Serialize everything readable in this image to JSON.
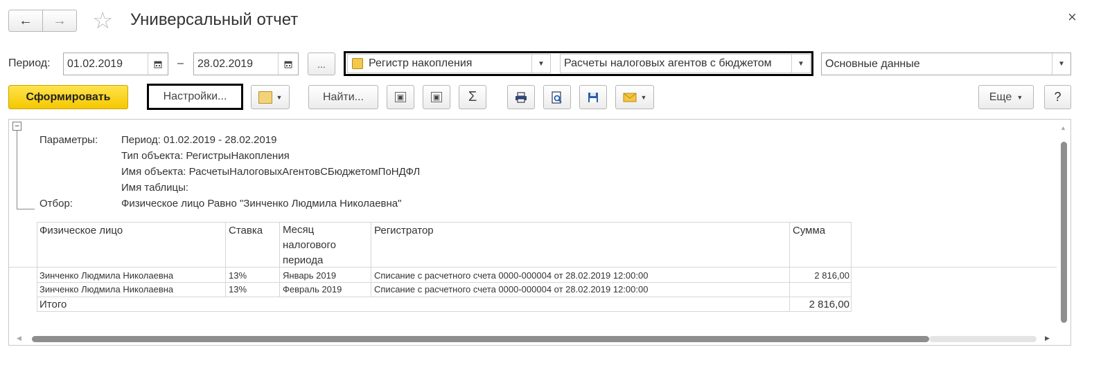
{
  "window": {
    "title": "Универсальный отчет",
    "close": "×"
  },
  "nav": {
    "back": "←",
    "forward": "→",
    "favorite": "☆"
  },
  "period": {
    "label": "Период:",
    "from": "01.02.2019",
    "dash": "–",
    "to": "28.02.2019",
    "more": "..."
  },
  "selectors": {
    "object_type": "Регистр накопления",
    "object_name": "Расчеты налоговых агентов с бюджетом",
    "table": "Основные данные"
  },
  "toolbar": {
    "generate": "Сформировать",
    "settings": "Настройки...",
    "find": "Найти...",
    "sum": "Σ",
    "more": "Еще",
    "help": "?"
  },
  "report": {
    "collapse": "−",
    "params_label": "Параметры:",
    "filter_label": "Отбор:",
    "params": [
      "Период: 01.02.2019 - 28.02.2019",
      "Тип объекта: РегистрыНакопления",
      "Имя объекта: РасчетыНалоговыхАгентовСБюджетомПоНДФЛ",
      "Имя таблицы:"
    ],
    "filter": "Физическое лицо Равно \"Зинченко Людмила Николаевна\"",
    "columns": [
      "Физическое лицо",
      "Ставка",
      "Месяц\nналогового\nпериода",
      "Регистратор",
      "Сумма"
    ],
    "rows": [
      [
        "Зинченко Людмила Николаевна",
        "13%",
        "Январь 2019",
        "Списание с расчетного счета 0000-000004 от 28.02.2019 12:00:00",
        "2 816,00"
      ],
      [
        "Зинченко Людмила Николаевна",
        "13%",
        "Февраль 2019",
        "Списание с расчетного счета 0000-000004 от 28.02.2019 12:00:00",
        ""
      ]
    ],
    "total_label": "Итого",
    "total_value": "2 816,00"
  }
}
